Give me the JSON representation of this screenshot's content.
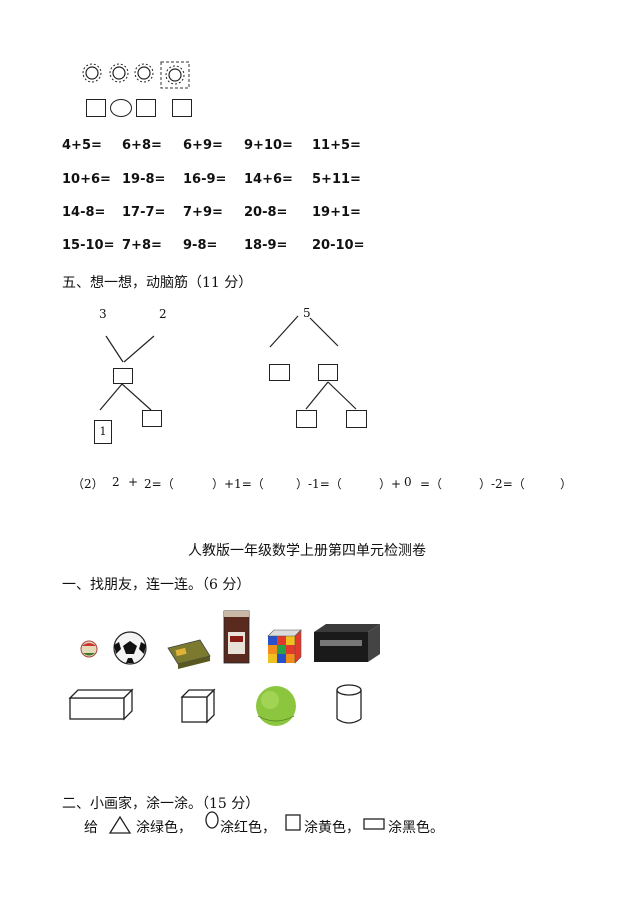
{
  "math_rows": [
    [
      "4+5=",
      "6+8=",
      "6+9=",
      "9+10=",
      "11+5="
    ],
    [
      "10+6=",
      "19-8=",
      "16-9=",
      "14+6=",
      "5+11="
    ],
    [
      "14-8=",
      "17-7=",
      "7+9=",
      "20-8=",
      "19+1="
    ],
    [
      "15-10=",
      "7+8=",
      "9-8=",
      "18-9=",
      "20-10="
    ]
  ],
  "section5": {
    "title": "五、想一想，动脑筋（11 分）",
    "tree1": {
      "left": "3",
      "right": "2",
      "leaf": "1"
    },
    "tree2": {
      "top": "5"
    },
    "chain": [
      "（2）",
      "2",
      "+",
      "2=（",
      "）+1=（",
      "）-1=（",
      "）+",
      "0",
      "=（",
      "）-2=（",
      "）"
    ]
  },
  "doc_title": "人教版一年级数学上册第四单元检测卷",
  "section1": {
    "title": "一、找朋友，连一连。（6 分）"
  },
  "section2": {
    "title": "二、小画家，涂一涂。（15 分）",
    "instr_prefix": "给",
    "instr_triangle": "涂绿色，",
    "instr_circle": "涂红色，",
    "instr_square": "涂黄色，",
    "instr_rect": "涂黑色。"
  }
}
